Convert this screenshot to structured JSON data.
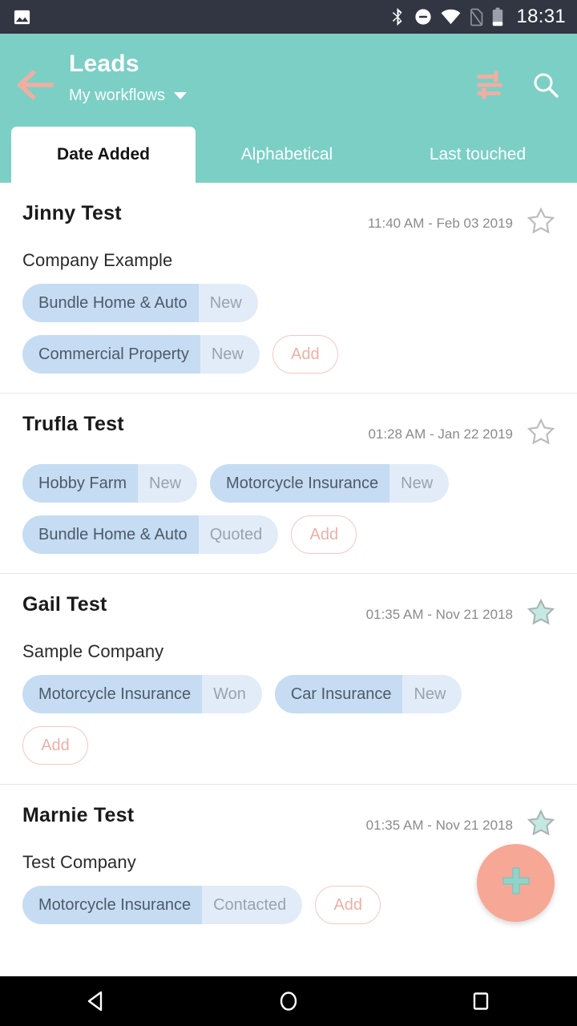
{
  "statusbar": {
    "time": "18:31",
    "icons": [
      "image-icon",
      "bluetooth-icon",
      "do-not-disturb-icon",
      "wifi-icon",
      "no-sim-icon",
      "battery-icon"
    ]
  },
  "header": {
    "title": "Leads",
    "subtitle": "My workflows",
    "back_icon": "back-arrow-icon",
    "filter_icon": "filter-sliders-icon",
    "search_icon": "search-icon",
    "dropdown_icon": "chevron-down-icon",
    "background_color": "#7CCFC5",
    "accent_color": "#F7A795"
  },
  "tabs": [
    {
      "label": "Date Added",
      "active": true
    },
    {
      "label": "Alphabetical",
      "active": false
    },
    {
      "label": "Last touched",
      "active": false
    }
  ],
  "leads": [
    {
      "name": "Jinny Test",
      "timestamp": "11:40 AM - Feb 03 2019",
      "company": "Company Example",
      "starred": false,
      "star_icon": "star-outline-icon",
      "rows": [
        {
          "chips": [
            {
              "label": "Bundle Home & Auto",
              "status": "New"
            }
          ],
          "add": null
        },
        {
          "chips": [
            {
              "label": "Commercial Property",
              "status": "New"
            }
          ],
          "add": "Add"
        }
      ]
    },
    {
      "name": "Trufla Test",
      "timestamp": "01:28 AM - Jan 22 2019",
      "company": "",
      "starred": false,
      "star_icon": "star-outline-icon",
      "rows": [
        {
          "chips": [
            {
              "label": "Hobby Farm",
              "status": "New"
            },
            {
              "label": "Motorcycle Insurance",
              "status": "New"
            }
          ],
          "add": null
        },
        {
          "chips": [
            {
              "label": "Bundle Home & Auto",
              "status": "Quoted"
            }
          ],
          "add": "Add"
        }
      ]
    },
    {
      "name": "Gail Test",
      "timestamp": "01:35 AM - Nov 21 2018",
      "company": "Sample Company",
      "starred": true,
      "star_icon": "star-filled-icon",
      "rows": [
        {
          "chips": [
            {
              "label": "Motorcycle Insurance",
              "status": "Won"
            },
            {
              "label": "Car Insurance",
              "status": "New"
            }
          ],
          "add": null
        },
        {
          "chips": [],
          "add": "Add"
        }
      ]
    },
    {
      "name": "Marnie Test",
      "timestamp": "01:35 AM - Nov 21 2018",
      "company": "Test Company",
      "starred": true,
      "star_icon": "star-filled-icon",
      "rows": [
        {
          "chips": [
            {
              "label": "Motorcycle Insurance",
              "status": "Contacted"
            }
          ],
          "add": "Add"
        }
      ]
    }
  ],
  "fab": {
    "icon": "plus-icon",
    "color": "#F7A795",
    "icon_color": "#8FD4CB"
  },
  "navbar": {
    "back": "nav-back-icon",
    "home": "nav-home-icon",
    "recents": "nav-recents-icon"
  }
}
